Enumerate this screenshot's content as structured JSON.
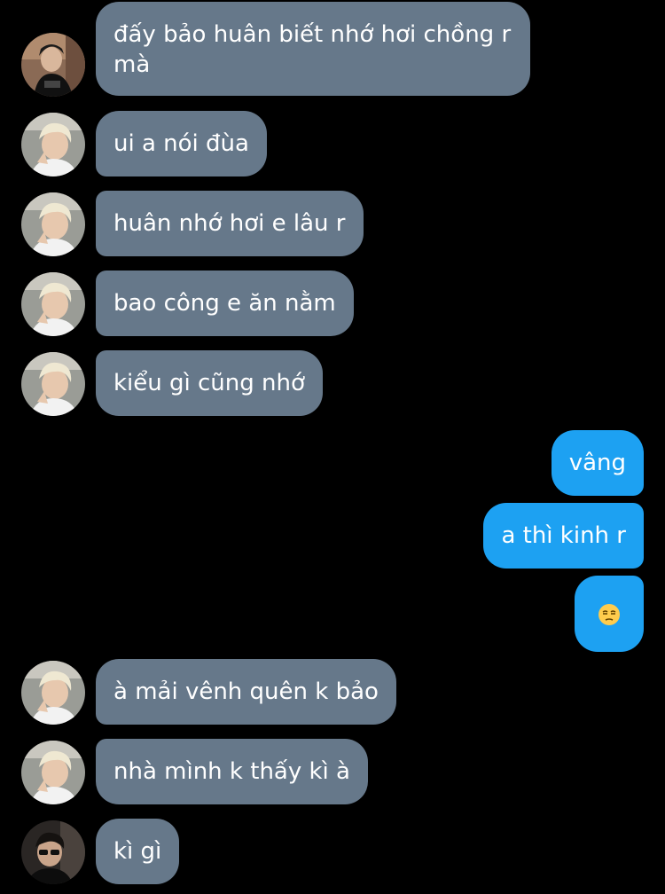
{
  "conversation": {
    "messages": [
      {
        "sender": "other",
        "avatar": "avatar-dark-hair",
        "text": "đấy bảo huân biết nhớ hơi chồng r mà"
      },
      {
        "sender": "other",
        "avatar": "avatar-blonde",
        "text": "ui a nói đùa"
      },
      {
        "sender": "other",
        "avatar": "avatar-blonde",
        "text": "huân nhớ hơi e lâu r"
      },
      {
        "sender": "other",
        "avatar": "avatar-blonde",
        "text": "bao công e ăn nằm"
      },
      {
        "sender": "other",
        "avatar": "avatar-blonde",
        "text": "kiểu gì cũng nhớ"
      },
      {
        "sender": "me",
        "text": "vâng"
      },
      {
        "sender": "me",
        "text": "a thì kinh r"
      },
      {
        "sender": "me",
        "emoji": "unamused-face-icon"
      },
      {
        "sender": "other",
        "avatar": "avatar-blonde",
        "text": "à mải vênh quên k bảo"
      },
      {
        "sender": "other",
        "avatar": "avatar-blonde",
        "text": "nhà mình k thấy kì à"
      },
      {
        "sender": "other",
        "avatar": "avatar-dark-glasses",
        "text": "kì gì"
      }
    ]
  },
  "colors": {
    "background": "#000000",
    "incoming_bubble": "#66788a",
    "outgoing_bubble": "#1da1f2",
    "text": "#ffffff"
  }
}
